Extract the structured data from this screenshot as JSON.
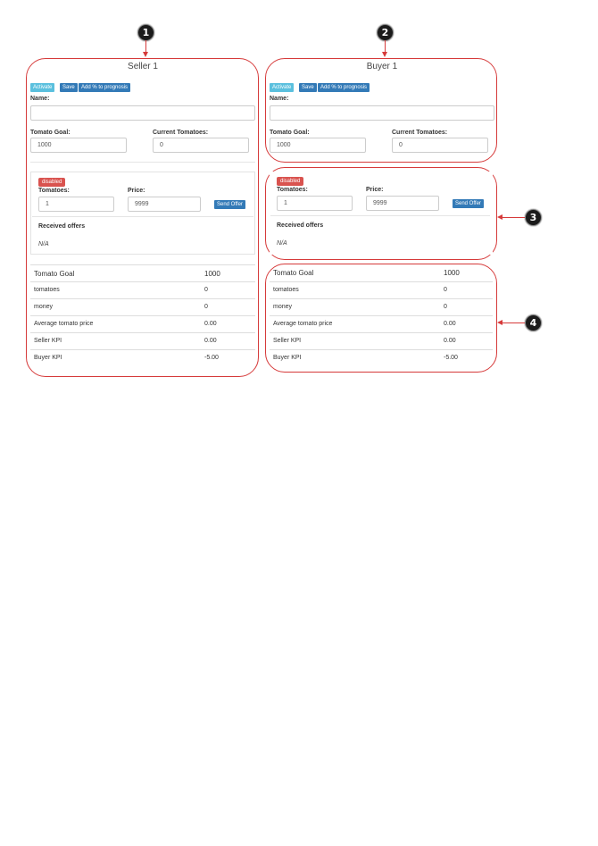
{
  "callouts": [
    "1",
    "2",
    "3",
    "4"
  ],
  "seller": {
    "title": "Seller 1",
    "buttons": {
      "activate": "Activate",
      "save": "Save",
      "add_prognosis": "Add % to prognosis"
    },
    "name_label": "Name:",
    "name_value": "",
    "goal_label": "Tomato Goal:",
    "goal_value": "1000",
    "current_label": "Current Tomatoes:",
    "current_value": "0",
    "offer": {
      "badge": "disabled",
      "tomatoes_label": "Tomatoes:",
      "tomatoes_value": "1",
      "price_label": "Price:",
      "price_value": "9999",
      "send_label": "Send Offer",
      "received_label": "Received offers",
      "received_value": "N/A"
    },
    "stats": [
      {
        "label": "Tomato Goal",
        "value": "1000"
      },
      {
        "label": "tomatoes",
        "value": "0"
      },
      {
        "label": "money",
        "value": "0"
      },
      {
        "label": "Average tomato price",
        "value": "0.00"
      },
      {
        "label": "Seller KPI",
        "value": "0.00"
      },
      {
        "label": "Buyer KPI",
        "value": "-5.00"
      }
    ]
  },
  "buyer": {
    "title": "Buyer 1",
    "buttons": {
      "activate": "Activate",
      "save": "Save",
      "add_prognosis": "Add % to prognosis"
    },
    "name_label": "Name:",
    "name_value": "",
    "goal_label": "Tomato Goal:",
    "goal_value": "1000",
    "current_label": "Current Tomatoes:",
    "current_value": "0",
    "offer": {
      "badge": "disabled",
      "tomatoes_label": "Tomatoes:",
      "tomatoes_value": "1",
      "price_label": "Price:",
      "price_value": "9999",
      "send_label": "Send Offer",
      "received_label": "Received offers",
      "received_value": "N/A"
    },
    "stats": [
      {
        "label": "Tomato Goal",
        "value": "1000"
      },
      {
        "label": "tomatoes",
        "value": "0"
      },
      {
        "label": "money",
        "value": "0"
      },
      {
        "label": "Average tomato price",
        "value": "0.00"
      },
      {
        "label": "Seller KPI",
        "value": "0.00"
      },
      {
        "label": "Buyer KPI",
        "value": "-5.00"
      }
    ]
  },
  "colors": {
    "annotation_red": "#d63a3a",
    "btn_info": "#5bc0de",
    "btn_primary": "#337ab7",
    "badge_danger": "#d9534f"
  }
}
